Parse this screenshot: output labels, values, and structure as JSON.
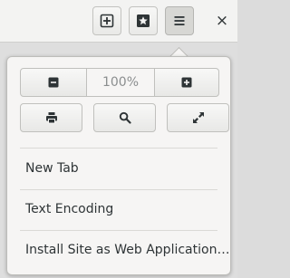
{
  "header": {
    "buttons": [
      {
        "name": "new-tab-button",
        "icon": "plus-square-icon"
      },
      {
        "name": "bookmark-button",
        "icon": "star-square-icon"
      },
      {
        "name": "main-menu-button",
        "icon": "hamburger-icon",
        "active": true
      }
    ],
    "close_label": "×"
  },
  "menu": {
    "zoom": {
      "level": "100%",
      "out_icon": "minus-icon",
      "in_icon": "plus-icon"
    },
    "tools": [
      {
        "name": "print-button",
        "icon": "printer-icon"
      },
      {
        "name": "find-button",
        "icon": "search-icon"
      },
      {
        "name": "fullscreen-button",
        "icon": "expand-icon"
      }
    ],
    "items": [
      {
        "label": "New Tab"
      },
      {
        "label": "Text Encoding"
      },
      {
        "label": "Install Site as Web Application…"
      }
    ]
  }
}
